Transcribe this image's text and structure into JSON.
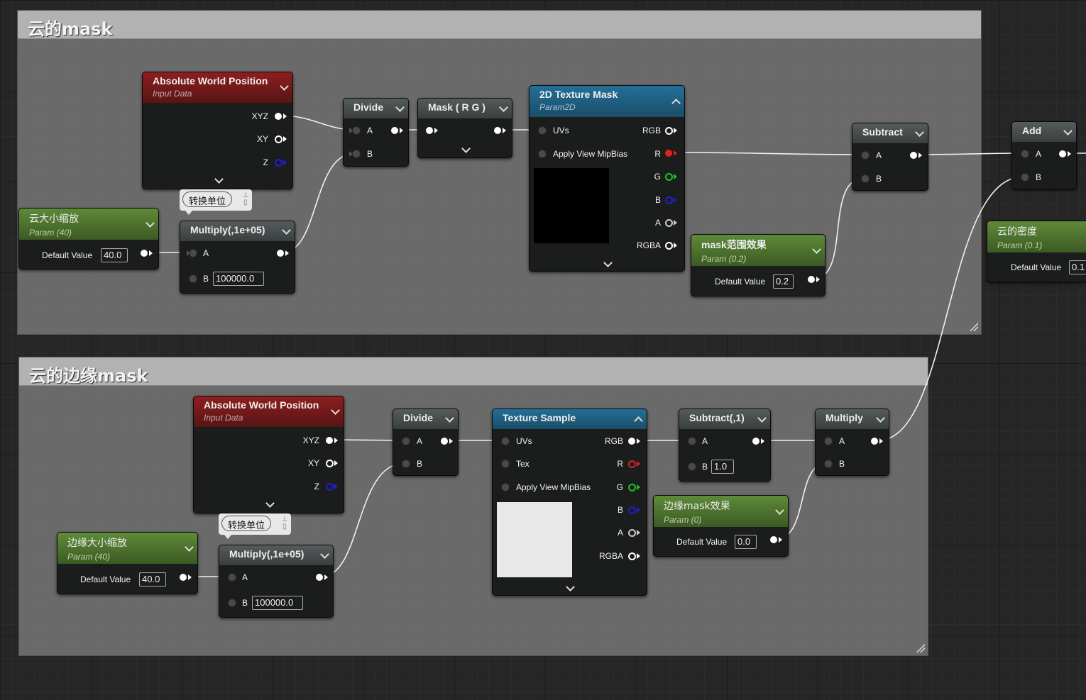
{
  "comments": {
    "top": {
      "title": "云的mask"
    },
    "bottom": {
      "title": "云的边缘mask"
    }
  },
  "top": {
    "abs_pos": {
      "title": "Absolute World Position",
      "subtitle": "Input Data",
      "out_xyz": "XYZ",
      "out_xy": "XY",
      "out_z": "Z"
    },
    "reroute": {
      "label": "转换单位",
      "pin_icon": "pin-icon"
    },
    "scale_param": {
      "title": "云大小缩放",
      "subtitle": "Param (40)",
      "default_label": "Default Value",
      "default_value": "40.0"
    },
    "multiply": {
      "title": "Multiply(,1e+05)",
      "in_a": "A",
      "in_b": "B",
      "b_value": "100000.0"
    },
    "divide": {
      "title": "Divide",
      "in_a": "A",
      "in_b": "B"
    },
    "mask_rg": {
      "title": "Mask ( R G )"
    },
    "texture_mask": {
      "title": "2D Texture Mask",
      "subtitle": "Param2D",
      "in_uvs": "UVs",
      "in_mip": "Apply View MipBias",
      "out_rgb": "RGB",
      "out_r": "R",
      "out_g": "G",
      "out_b": "B",
      "out_a": "A",
      "out_rgba": "RGBA",
      "preview_color": "#000000"
    },
    "mask_range": {
      "title": "mask范围效果",
      "subtitle": "Param (0.2)",
      "default_label": "Default Value",
      "default_value": "0.2"
    },
    "subtract": {
      "title": "Subtract",
      "in_a": "A",
      "in_b": "B"
    },
    "add": {
      "title": "Add",
      "in_a": "A",
      "in_b": "B"
    },
    "density": {
      "title": "云的密度",
      "subtitle": "Param (0.1)",
      "default_label": "Default Value",
      "default_value": "0.1"
    }
  },
  "bottom": {
    "abs_pos": {
      "title": "Absolute World Position",
      "subtitle": "Input Data",
      "out_xyz": "XYZ",
      "out_xy": "XY",
      "out_z": "Z"
    },
    "reroute": {
      "label": "转换单位",
      "pin_icon": "pin-icon"
    },
    "scale_param": {
      "title": "边缘大小缩放",
      "subtitle": "Param (40)",
      "default_label": "Default Value",
      "default_value": "40.0"
    },
    "multiply": {
      "title": "Multiply(,1e+05)",
      "in_a": "A",
      "in_b": "B",
      "b_value": "100000.0"
    },
    "divide": {
      "title": "Divide",
      "in_a": "A",
      "in_b": "B"
    },
    "texture_sample": {
      "title": "Texture Sample",
      "in_uvs": "UVs",
      "in_tex": "Tex",
      "in_mip": "Apply View MipBias",
      "out_rgb": "RGB",
      "out_r": "R",
      "out_g": "G",
      "out_b": "B",
      "out_a": "A",
      "out_rgba": "RGBA",
      "preview_color": "#e8e8e8"
    },
    "subtract1": {
      "title": "Subtract(,1)",
      "in_a": "A",
      "in_b": "B",
      "b_value": "1.0"
    },
    "edge_param": {
      "title": "边缘mask效果",
      "subtitle": "Param (0)",
      "default_label": "Default Value",
      "default_value": "0.0"
    },
    "multiply2": {
      "title": "Multiply",
      "in_a": "A",
      "in_b": "B"
    }
  },
  "colors": {
    "red_pin": "#e02020",
    "green_pin": "#20c020",
    "blue_pin": "#2020d0",
    "wire": "#f0f0f0"
  }
}
